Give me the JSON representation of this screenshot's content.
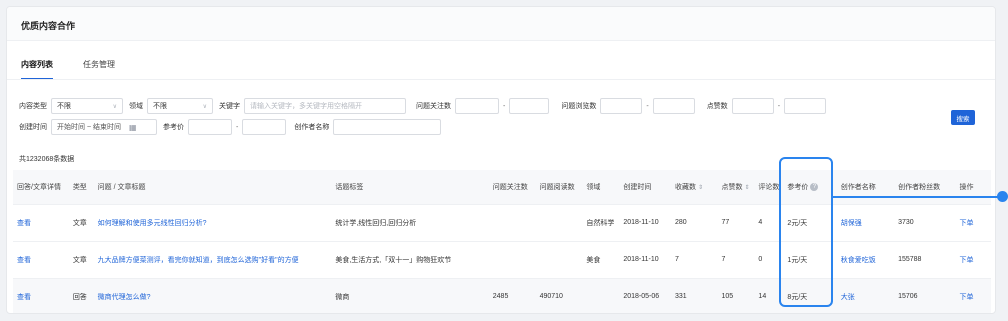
{
  "header": {
    "title": "优质内容合作"
  },
  "tabs": [
    {
      "label": "内容列表"
    },
    {
      "label": "任务管理"
    }
  ],
  "filters": {
    "content_type_label": "内容类型",
    "content_type_value": "不限",
    "domain_label": "领域",
    "domain_value": "不限",
    "keyword_label": "关键字",
    "keyword_placeholder": "请输入关键字，多关键字用空格隔开",
    "follow_label": "问题关注数",
    "views_label": "问题浏览数",
    "likes_label": "点赞数",
    "created_label": "创建时间",
    "date_placeholder": "开始时间 ~ 结束时间",
    "ref_price_label": "参考价",
    "creator_label": "创作者名称",
    "search_label": "搜索"
  },
  "total_text": "共1232068条数据",
  "table": {
    "columns": [
      "回答/文章详情",
      "类型",
      "问题 / 文章标题",
      "话题标签",
      "问题关注数",
      "问题阅读数",
      "领域",
      "创建时间",
      "收藏数",
      "点赞数",
      "评论数",
      "参考价",
      "创作者名称",
      "创作者粉丝数",
      "操作"
    ],
    "rows": [
      {
        "detail": "查看",
        "type": "文章",
        "title": "如何理解和使用多元线性回归分析?",
        "tags": "统计学,线性回归,回归分析",
        "follow": "",
        "reads": "",
        "domain": "自然科学",
        "date": "2018-11-10",
        "fav": "280",
        "likes": "77",
        "comments": "4",
        "price": "2元/天",
        "creator": "胡保强",
        "fans": "3730",
        "action": "下单"
      },
      {
        "detail": "查看",
        "type": "文章",
        "title": "九大品牌方便菜测评，看完你就知道，到底怎么选购\"好看\"的方便",
        "tags": "美食,生活方式,「双十一」购物狂欢节",
        "follow": "",
        "reads": "",
        "domain": "美食",
        "date": "2018-11-10",
        "fav": "7",
        "likes": "7",
        "comments": "0",
        "price": "1元/天",
        "creator": "秋食爱吃饭",
        "fans": "155788",
        "action": "下单"
      },
      {
        "detail": "查看",
        "type": "回答",
        "title": "微商代理怎么做?",
        "tags": "微商",
        "follow": "2485",
        "reads": "490710",
        "domain": "",
        "date": "2018-05-06",
        "fav": "331",
        "likes": "105",
        "comments": "14",
        "price": "8元/天",
        "creator": "大张",
        "fans": "15706",
        "action": "下单"
      }
    ]
  },
  "colors": {
    "accent": "#1f64d8",
    "highlight": "#2a84ee"
  },
  "icons": {
    "calendar": "calendar-icon",
    "help": "help-icon",
    "sort": "sort-icon",
    "dropdown": "chevron-down-icon"
  }
}
